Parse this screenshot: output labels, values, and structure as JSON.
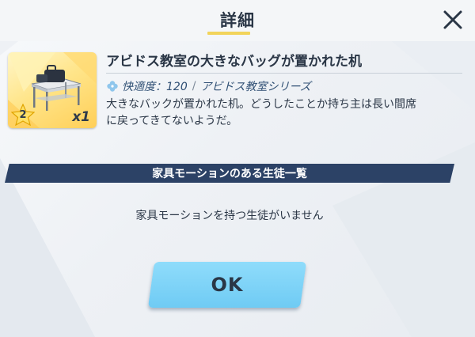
{
  "header": {
    "title": "詳細",
    "close_icon": "close-icon"
  },
  "item": {
    "name": "アビドス教室の大きなバッグが置かれた机",
    "quantity": "x1",
    "rarity_stars": "2",
    "comfort_label": "快適度：120",
    "series": "アビドス教室シリーズ",
    "separator": "/",
    "description_line1": "大きなバックが置かれた机。どうしたことか持ち主は長い間席",
    "description_line2": "に戻ってきてないようだ。",
    "icon": "desk-with-bag-icon"
  },
  "section": {
    "title": "家具モーションのある生徒一覧",
    "empty_message": "家具モーションを持つ生徒がいません"
  },
  "footer": {
    "ok_label": "OK"
  },
  "colors": {
    "accent_yellow": "#f2d45a",
    "banner_navy": "#2c4266",
    "ok_button": "#7fd3f7",
    "text_dark": "#2a3646"
  }
}
